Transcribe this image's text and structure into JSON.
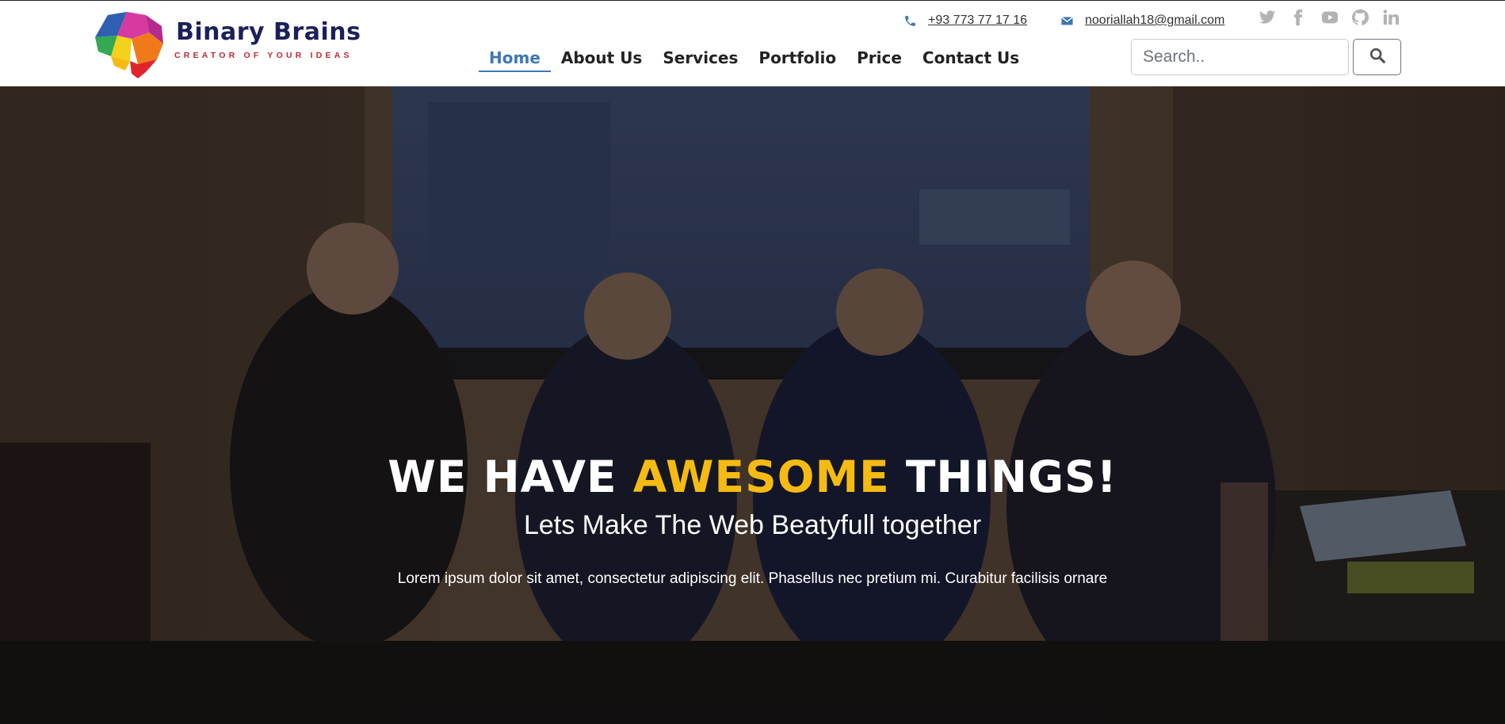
{
  "brand": {
    "name": "Binary Brains",
    "tagline": "CREATOR OF YOUR IDEAS"
  },
  "contact": {
    "phone": "+93 773 77 17 16",
    "email": "nooriallah18@gmail.com"
  },
  "socials": [
    "twitter-icon",
    "facebook-icon",
    "youtube-icon",
    "github-icon",
    "linkedin-icon"
  ],
  "nav": {
    "items": [
      {
        "label": "Home",
        "active": true
      },
      {
        "label": "About Us"
      },
      {
        "label": "Services"
      },
      {
        "label": "Portfolio"
      },
      {
        "label": "Price"
      },
      {
        "label": "Contact Us"
      }
    ]
  },
  "search": {
    "placeholder": "Search..",
    "icon": "search-icon"
  },
  "hero": {
    "title_part1": "WE HAVE ",
    "title_highlight": "AWESOME",
    "title_part2": " THINGS!",
    "subtitle": "Lets Make The Web Beatyfull together",
    "text": "Lorem ipsum dolor sit amet, consectetur adipiscing elit. Phasellus nec pretium mi. Curabitur facilisis ornare"
  },
  "colors": {
    "accent": "#3d77b5",
    "highlight": "#f6bb12",
    "brand_dark": "#1b1f5a",
    "brand_red": "#c2282e"
  }
}
